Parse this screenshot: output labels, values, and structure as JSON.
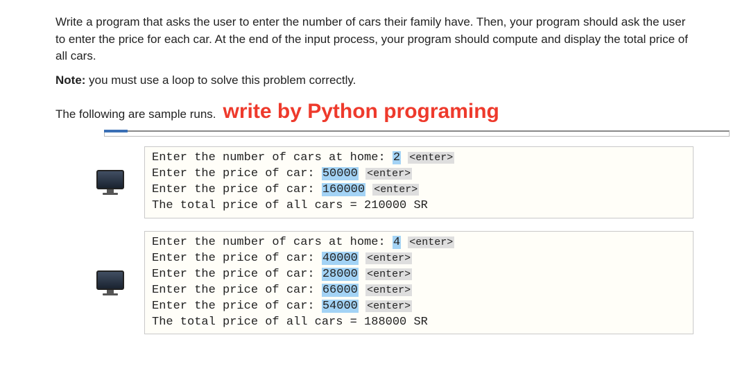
{
  "problem": {
    "p1": "Write a program that asks the user to enter the number of cars their family have. Then, your program should ask the user to enter the price for each car. At the end of the input process, your program should compute and display the total price of all cars.",
    "note_label": "Note:",
    "note_text": " you must use a loop to solve this problem correctly.",
    "sample_lead": "The following are sample runs.",
    "headline": "write by Python programing"
  },
  "enter_tag": "<enter>",
  "run1": {
    "l0_a": "Enter the number of cars at home: ",
    "l0_in": "2",
    "l1_a": "Enter the price of car: ",
    "l1_in": "50000",
    "l2_a": "Enter the price of car: ",
    "l2_in": "160000",
    "l3": "The total price of all cars = 210000 SR"
  },
  "run2": {
    "l0_a": "Enter the number of cars at home: ",
    "l0_in": "4",
    "l1_a": "Enter the price of car: ",
    "l1_in": "40000",
    "l2_a": "Enter the price of car: ",
    "l2_in": "28000",
    "l3_a": "Enter the price of car: ",
    "l3_in": "66000",
    "l4_a": "Enter the price of car: ",
    "l4_in": "54000",
    "l5": "The total price of all cars = 188000 SR"
  }
}
